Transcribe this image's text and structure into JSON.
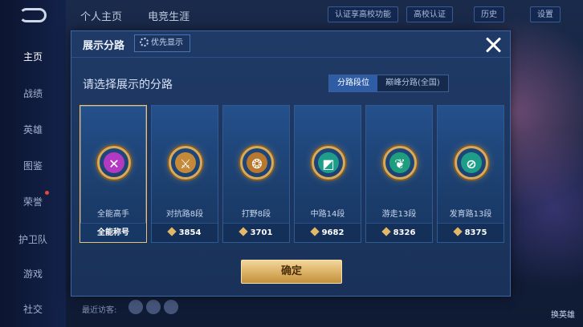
{
  "background": {
    "sidebar_items": [
      {
        "label": "主页",
        "active": true
      },
      {
        "label": "战绩",
        "active": false
      },
      {
        "label": "英雄",
        "active": false
      },
      {
        "label": "图鉴",
        "active": false
      },
      {
        "label": "荣誉",
        "active": false
      },
      {
        "label": "护卫队",
        "active": false
      },
      {
        "label": "游戏",
        "active": false
      },
      {
        "label": "社交",
        "active": false
      }
    ],
    "top_tabs": [
      "个人主页",
      "电竞生涯"
    ],
    "top_buttons": [
      "认证享高校功能",
      "高校认证",
      "历史",
      "设置"
    ],
    "right_labels": [
      "换英雄"
    ],
    "footer_hint": "最近访客:"
  },
  "modal": {
    "title": "展示分路",
    "priority_button": "优先显示",
    "prompt": "请选择展示的分路",
    "tabs": [
      {
        "label": "分路段位",
        "active": true
      },
      {
        "label": "巅峰分路(全国)",
        "active": false
      }
    ],
    "confirm_label": "确定"
  },
  "cards": [
    {
      "name": "全能高手",
      "footer": "全能称号",
      "score": "",
      "selected": true,
      "badge_icon": "all-round-icon",
      "badge_color": "#b23ac2",
      "glyph": "✕"
    },
    {
      "name": "对抗路8段",
      "footer": "3854",
      "score": "3854",
      "selected": false,
      "badge_icon": "clash-lane-icon",
      "badge_color": "#c48a3a",
      "glyph": "⚔"
    },
    {
      "name": "打野8段",
      "footer": "3701",
      "score": "3701",
      "selected": false,
      "badge_icon": "jungle-icon",
      "badge_color": "#b8782e",
      "glyph": "❂"
    },
    {
      "name": "中路14段",
      "footer": "9682",
      "score": "9682",
      "selected": false,
      "badge_icon": "mid-lane-icon",
      "badge_color": "#1e9e8a",
      "glyph": "◩"
    },
    {
      "name": "游走13段",
      "footer": "8326",
      "score": "8326",
      "selected": false,
      "badge_icon": "roam-icon",
      "badge_color": "#1e9e7e",
      "glyph": "❦"
    },
    {
      "name": "发育路13段",
      "footer": "8375",
      "score": "8375",
      "selected": false,
      "badge_icon": "farm-lane-icon",
      "badge_color": "#1e9e88",
      "glyph": "⊘"
    }
  ]
}
